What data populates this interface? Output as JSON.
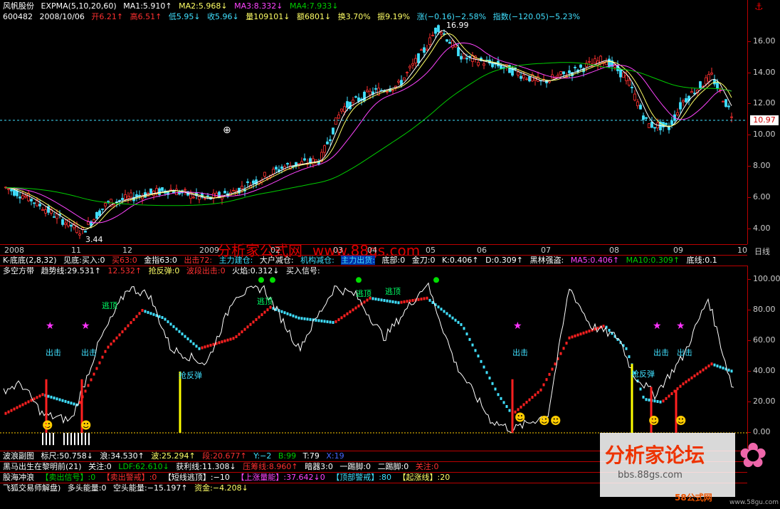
{
  "header": {
    "title": "风帆股份",
    "expma": "EXPMA(5,10,20,60)",
    "ma1": "MA1:5.910↑",
    "ma2": "MA2:5.968↓",
    "ma3": "MA3:8.332↓",
    "ma4": "MA4:7.933↓",
    "code": "600482",
    "date": "2008/10/06",
    "open": "开6.21↑",
    "high": "高6.51↑",
    "low": "低5.95↓",
    "close": "收5.96↓",
    "volume": "量109101↓",
    "amount": "额6801↓",
    "turnover": "换3.70%",
    "amplitude": "振9.19%",
    "change": "涨(−0.16)−2.58%",
    "index": "指数(−120.05)−5.23%"
  },
  "main_chart": {
    "y_ticks": [
      "16.00",
      "14.00",
      "12.00",
      "10.00",
      "8.00",
      "6.00",
      "4.00"
    ],
    "current_price": "10.97",
    "high_label": "16.99",
    "low_label": "3.44",
    "colors": {
      "up": "#ff3030",
      "down": "#40e0ff",
      "ma1": "#ffffff",
      "ma2": "#ffff66",
      "ma3": "#ff44ff",
      "ma4": "#00cc00"
    }
  },
  "watermark": {
    "center": "分析家公式网",
    "center_url": "www.88gs.com",
    "forum": "分析家论坛",
    "forum_url": "bbs.88gs.com",
    "logo": "58公式网",
    "logo_url": "www.58gu.com"
  },
  "date_axis": [
    "2008",
    "11",
    "12",
    "2009",
    "02",
    "03",
    "04",
    "05",
    "06",
    "07",
    "08",
    "09",
    "10",
    "日线"
  ],
  "k_bottom": {
    "title": "K-底底(2,8,32)",
    "jd": "见底:买入:0",
    "buy": "买63:0",
    "jz": "金指63:0",
    "out": "出击72:",
    "zljc": "主力建仓:",
    "dhjc": "大户减仓:",
    "jgjc": "机构减仓:",
    "zlch": "主力出货:",
    "db": "底部:0",
    "jd2": "金刀:0",
    "k": "K:0.406↑",
    "d": "D:0.309↑",
    "blqs": "黑林强盗:",
    "ma5": "MA5:0.406↑",
    "ma10": "MA10:0.309↑",
    "dx": "底线:0.1"
  },
  "lower_panel": {
    "title": "多空方带",
    "trend": "趋势线:29.531↑",
    "val2": "12.532↑",
    "fd": "抢反弹:0",
    "bd": "波段出击:0",
    "hy": "火焰:0.312↓",
    "mr": "买入信号:",
    "y_ticks": [
      "100.00",
      "80.00",
      "60.00",
      "40.00",
      "20.00",
      "0.00"
    ],
    "labels": {
      "escape": "逃顶",
      "strike": "出击",
      "rebound": "抢反弹"
    }
  },
  "bottom_rows": {
    "r1": [
      "波浪副图",
      "标尺:50.758↓",
      "浪:34.530↑",
      "波:25.294↑",
      "段:20.677↑",
      "Y:−2",
      "B:99",
      "T:79",
      "X:19"
    ],
    "r2": [
      "黑马出生在黎明前(21)",
      "关注:0",
      "LDF:62.610↓",
      "获利线:11.308↓",
      "压筹线:8.960↑",
      "暗器3:0",
      "一踢脚:0",
      "二踢脚:0",
      "关注:0"
    ],
    "r3": [
      "股海冲浪",
      "【卖出信号】:0",
      "【卖出警戒】:0",
      "【短线逃顶】:−10",
      "【上涨量能】:37.642↓0",
      "【顶部警戒】:80",
      "【起涨线】:20"
    ],
    "r4": [
      "飞狐交易师解盘)",
      "多头能量:0",
      "空头能量:−15.197↑",
      "资金:−4.208↓"
    ]
  }
}
